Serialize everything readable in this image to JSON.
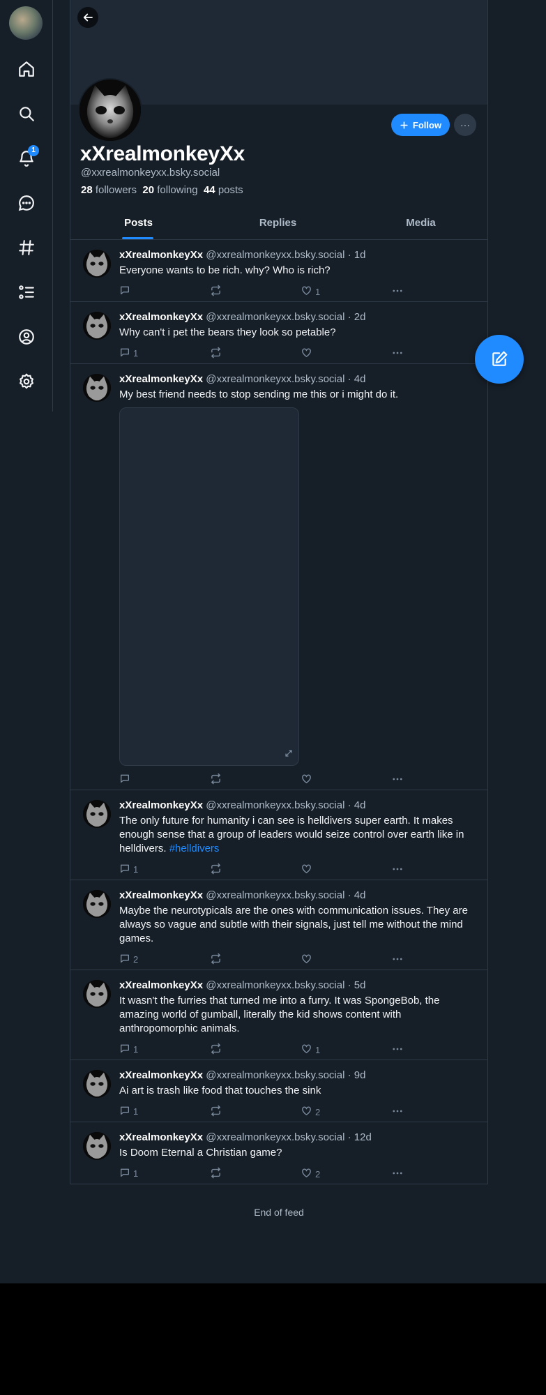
{
  "nav": {
    "notification_count": "1",
    "items": [
      "home-icon",
      "search-icon",
      "notifications-icon",
      "chat-icon",
      "feeds-icon",
      "lists-icon",
      "profile-icon",
      "settings-icon"
    ]
  },
  "profile": {
    "display_name": "xXrealmonkeyXx",
    "handle": "@xxrealmonkeyxx.bsky.social",
    "followers_count": "28",
    "followers_label": "followers",
    "following_count": "20",
    "following_label": "following",
    "posts_count": "44",
    "posts_label": "posts",
    "follow_label": "Follow",
    "more_label": "···"
  },
  "tabs": [
    "Posts",
    "Replies",
    "Media"
  ],
  "posts": [
    {
      "name": "xXrealmonkeyXx",
      "handle": "@xxrealmonkeyxx.bsky.social",
      "time": "1d",
      "text": "Everyone wants to be rich. why? Who is rich?",
      "replies": "",
      "likes": "1"
    },
    {
      "name": "xXrealmonkeyXx",
      "handle": "@xxrealmonkeyxx.bsky.social",
      "time": "2d",
      "text": "Why can't i pet the bears they look so petable?",
      "replies": "1",
      "likes": ""
    },
    {
      "name": "xXrealmonkeyXx",
      "handle": "@xxrealmonkeyxx.bsky.social",
      "time": "4d",
      "text": "My best friend needs to stop sending me this or i might do it.",
      "replies": "",
      "likes": "",
      "has_embed": true
    },
    {
      "name": "xXrealmonkeyXx",
      "handle": "@xxrealmonkeyxx.bsky.social",
      "time": "4d",
      "text": "The only future for humanity i can see is helldivers super earth. It makes enough sense that a group of leaders would seize control over earth like in helldivers.",
      "hashtag": "#helldivers",
      "replies": "1",
      "likes": ""
    },
    {
      "name": "xXrealmonkeyXx",
      "handle": "@xxrealmonkeyxx.bsky.social",
      "time": "4d",
      "text": "Maybe the neurotypicals are the ones with communication issues. They are always so vague and subtle with their signals, just tell me without the mind games.",
      "replies": "2",
      "likes": ""
    },
    {
      "name": "xXrealmonkeyXx",
      "handle": "@xxrealmonkeyxx.bsky.social",
      "time": "5d",
      "text": "It wasn't the furries that turned me into a furry. It was SpongeBob, the amazing world of gumball, literally the kid shows content with anthropomorphic animals.",
      "replies": "1",
      "likes": "1"
    },
    {
      "name": "xXrealmonkeyXx",
      "handle": "@xxrealmonkeyxx.bsky.social",
      "time": "9d",
      "text": "Ai art is trash like food that touches the sink",
      "replies": "1",
      "likes": "2"
    },
    {
      "name": "xXrealmonkeyXx",
      "handle": "@xxrealmonkeyxx.bsky.social",
      "time": "12d",
      "text": "Is Doom Eternal a Christian game?",
      "replies": "1",
      "likes": "2"
    }
  ],
  "feed_end": "End of feed",
  "colors": {
    "accent": "#208bfe",
    "background": "#161e27",
    "border": "#2e3a48",
    "muted": "#aebbc9"
  }
}
